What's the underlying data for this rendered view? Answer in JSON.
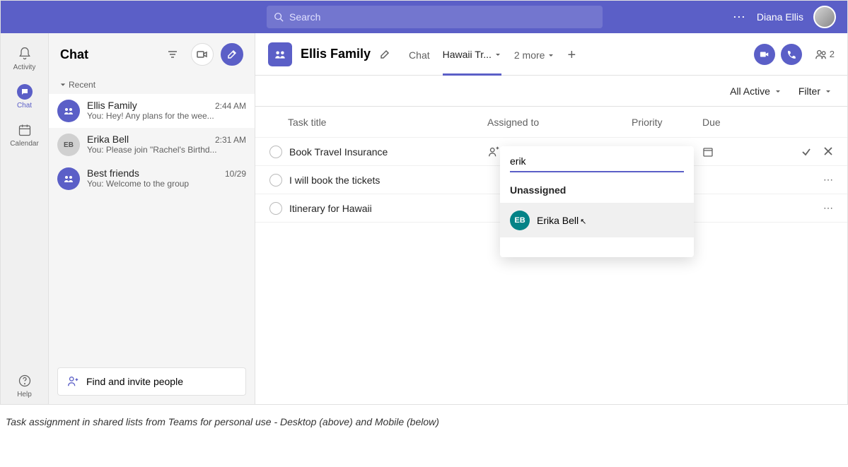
{
  "header": {
    "search_placeholder": "Search",
    "user_name": "Diana Ellis"
  },
  "rail": {
    "items": [
      {
        "label": "Activity"
      },
      {
        "label": "Chat"
      },
      {
        "label": "Calendar"
      }
    ],
    "help_label": "Help"
  },
  "chat_pane": {
    "title": "Chat",
    "recent_label": "Recent",
    "find_invite": "Find and invite people",
    "chats": [
      {
        "name": "Ellis Family",
        "time": "2:44 AM",
        "preview": "You: Hey! Any plans for the wee...",
        "avatar": "group"
      },
      {
        "name": "Erika Bell",
        "time": "2:31 AM",
        "preview": "You: Please join \"Rachel's Birthd...",
        "avatar": "EB"
      },
      {
        "name": "Best friends",
        "time": "10/29",
        "preview": "You: Welcome to the group",
        "avatar": "group"
      }
    ]
  },
  "main": {
    "group_name": "Ellis Family",
    "tabs": [
      {
        "label": "Chat"
      },
      {
        "label": "Hawaii Tr..."
      }
    ],
    "more_label": "2 more",
    "participant_count": "2",
    "filter_all": "All Active",
    "filter_label": "Filter",
    "columns": {
      "title": "Task title",
      "assigned": "Assigned to",
      "priority": "Priority",
      "due": "Due"
    },
    "tasks": [
      {
        "title": "Book Travel Insurance",
        "editing": true
      },
      {
        "title": "I will book the tickets",
        "editing": false
      },
      {
        "title": "Itinerary for Hawaii",
        "editing": false
      }
    ],
    "dropdown": {
      "search_value": "erik",
      "unassigned_label": "Unassigned",
      "option_initials": "EB",
      "option_name": "Erika Bell"
    }
  },
  "caption": "Task assignment in shared lists from Teams for personal use - Desktop (above) and Mobile (below)"
}
